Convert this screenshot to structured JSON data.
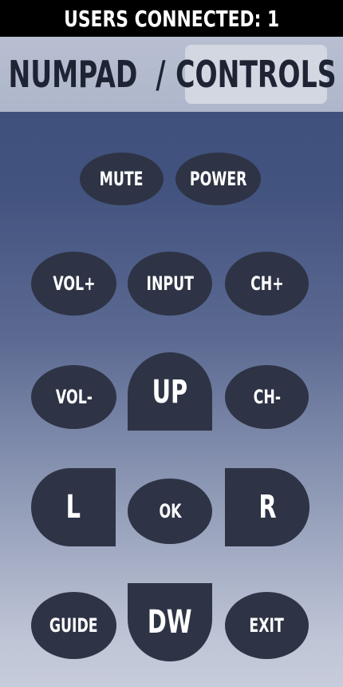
{
  "status": {
    "text": "USERS CONNECTED: 1"
  },
  "tabs": {
    "numpad": "NUMPAD",
    "separator": "/",
    "controls": "CONTROLS",
    "active": "CONTROLS"
  },
  "buttons": {
    "mute": "MUTE",
    "power": "POWER",
    "vol_up": "VOL+",
    "input": "INPUT",
    "ch_up": "CH+",
    "vol_down": "VOL-",
    "up": "UP",
    "ch_down": "CH-",
    "left": "L",
    "ok": "OK",
    "right": "R",
    "guide": "GUIDE",
    "down": "DW",
    "exit": "EXIT"
  },
  "colors": {
    "button": "#2e3445",
    "status_bar": "#000000",
    "active_tab": "#d3d7e2"
  }
}
